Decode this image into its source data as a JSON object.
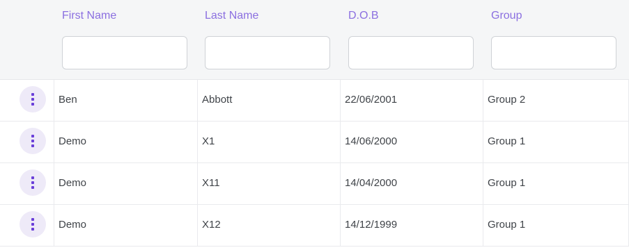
{
  "columns": [
    {
      "key": "first_name",
      "label": "First Name",
      "filter_value": ""
    },
    {
      "key": "last_name",
      "label": "Last Name",
      "filter_value": ""
    },
    {
      "key": "dob",
      "label": "D.O.B",
      "filter_value": ""
    },
    {
      "key": "group",
      "label": "Group",
      "filter_value": ""
    }
  ],
  "rows": [
    {
      "first_name": "Ben",
      "last_name": "Abbott",
      "dob": "22/06/2001",
      "group": "Group 2"
    },
    {
      "first_name": "Demo",
      "last_name": "X1",
      "dob": "14/06/2000",
      "group": "Group 1"
    },
    {
      "first_name": "Demo",
      "last_name": "X11",
      "dob": "14/04/2000",
      "group": "Group 1"
    },
    {
      "first_name": "Demo",
      "last_name": "X12",
      "dob": "14/12/1999",
      "group": "Group 1"
    }
  ],
  "icons": {
    "row_action": "more-vertical-icon"
  },
  "colors": {
    "accent": "#8b6fe0",
    "action_dots": "#6a3fd9",
    "action_bg": "#eeeaf8",
    "header_bg": "#f5f6f7",
    "text": "#3f4348"
  }
}
